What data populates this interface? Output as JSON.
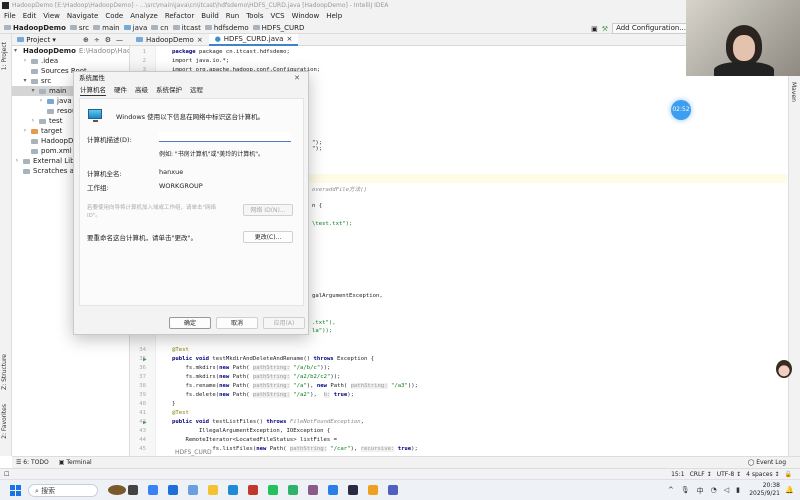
{
  "window": {
    "title": "HadoopDemo [E:\\Hadoop\\HadoopDemo] - ...\\src\\main\\java\\cn\\itcast\\hdfsdemo\\HDFS_CURD.java [HadoopDemo] - IntelliJ IDEA"
  },
  "menu": [
    "File",
    "Edit",
    "View",
    "Navigate",
    "Code",
    "Analyze",
    "Refactor",
    "Build",
    "Run",
    "Tools",
    "VCS",
    "Window",
    "Help"
  ],
  "breadcrumb": [
    "HadoopDemo",
    "src",
    "main",
    "java",
    "cn",
    "itcast",
    "hdfsdemo",
    "HDFS_CURD"
  ],
  "toolbar": {
    "add_config": "Add Configuration...",
    "project_label": "Project"
  },
  "editor_tabs": [
    "HadoopDemo",
    "HDFS_CURD.java"
  ],
  "side_tools": {
    "project": "1: Project",
    "structure": "Z: Structure",
    "favorites": "2: Favorites",
    "maven": "Maven"
  },
  "project_tree": [
    {
      "label": "HadoopDemo",
      "extra": "E:\\Hadoop\\HadoopDe",
      "depth": 0,
      "arrow": "▾",
      "icon": "module"
    },
    {
      "label": ".idea",
      "depth": 1,
      "arrow": "›",
      "icon": "folder"
    },
    {
      "label": "Sources Root",
      "depth": 1,
      "arrow": "",
      "icon": "folder"
    },
    {
      "label": "src",
      "depth": 1,
      "arrow": "▾",
      "icon": "folder"
    },
    {
      "label": "main",
      "depth": 2,
      "arrow": "▾",
      "icon": "folder",
      "selected": true
    },
    {
      "label": "java",
      "depth": 3,
      "arrow": "›",
      "icon": "folder-blue"
    },
    {
      "label": "resou",
      "depth": 3,
      "arrow": "",
      "icon": "folder"
    },
    {
      "label": "test",
      "depth": 2,
      "arrow": "›",
      "icon": "folder"
    },
    {
      "label": "target",
      "depth": 1,
      "arrow": "›",
      "icon": "folder-orange"
    },
    {
      "label": "HadoopDemo",
      "depth": 1,
      "arrow": "",
      "icon": "iml-file"
    },
    {
      "label": "pom.xml",
      "depth": 1,
      "arrow": "",
      "icon": "maven-file"
    },
    {
      "label": "External Libraries",
      "depth": 0,
      "arrow": "›",
      "icon": "library"
    },
    {
      "label": "Scratches and Co",
      "depth": 0,
      "arrow": "",
      "icon": "scratches"
    }
  ],
  "code": {
    "line1": "package cn.itcast.hdfsdemo;",
    "line2": "import java.io.*;",
    "line3": "import org.apache.hadoop.conf.Configuration;",
    "fragments": [
      "\");",
      "\");",
      "overaddFile方法()",
      "n {",
      "\\test.txt\");",
      "galArgumentException,",
      ".txt\"),",
      "la\"));"
    ],
    "lines_bottom": [
      {
        "n": "34",
        "parts": [
          [
            "ann",
            "@Test"
          ]
        ]
      },
      {
        "n": "35",
        "run": true,
        "parts": [
          [
            "kw",
            "public void "
          ],
          [
            "",
            "testMkdirAndDeleteAndRename() "
          ],
          [
            "kw",
            "throws "
          ],
          [
            "",
            "Exception {"
          ]
        ]
      },
      {
        "n": "36",
        "parts": [
          [
            "",
            "    fs.mkdirs("
          ],
          [
            "kw",
            "new "
          ],
          [
            "",
            "Path( "
          ],
          [
            "hint",
            "pathString:"
          ],
          [
            "str",
            " \"/a/b/c\""
          ],
          [
            "",
            "));"
          ]
        ]
      },
      {
        "n": "37",
        "parts": [
          [
            "",
            "    fs.mkdirs("
          ],
          [
            "kw",
            "new "
          ],
          [
            "",
            "Path( "
          ],
          [
            "hint",
            "pathString:"
          ],
          [
            "str",
            " \"/a2/b2/c2\""
          ],
          [
            "",
            "));"
          ]
        ]
      },
      {
        "n": "38",
        "parts": [
          [
            "",
            "    fs.rename("
          ],
          [
            "kw",
            "new "
          ],
          [
            "",
            "Path( "
          ],
          [
            "hint",
            "pathString:"
          ],
          [
            "str",
            " \"/a\""
          ],
          [
            "",
            "), "
          ],
          [
            "kw",
            "new "
          ],
          [
            "",
            "Path( "
          ],
          [
            "hint",
            "pathString:"
          ],
          [
            "str",
            " \"/a3\""
          ],
          [
            "",
            "));"
          ]
        ]
      },
      {
        "n": "39",
        "parts": [
          [
            "",
            "    fs.delete("
          ],
          [
            "kw",
            "new "
          ],
          [
            "",
            "Path( "
          ],
          [
            "hint",
            "pathString:"
          ],
          [
            "str",
            " \"/a2\""
          ],
          [
            "",
            "),  "
          ],
          [
            "hint",
            "b:"
          ],
          [
            "kw",
            " true"
          ],
          [
            "",
            ");"
          ]
        ]
      },
      {
        "n": "40",
        "parts": [
          [
            "",
            "}"
          ]
        ]
      },
      {
        "n": "41",
        "parts": [
          [
            "ann",
            "@Test"
          ]
        ]
      },
      {
        "n": "42",
        "run": true,
        "parts": [
          [
            "kw",
            "public void "
          ],
          [
            "",
            "testListFiles() "
          ],
          [
            "kw",
            "throws "
          ],
          [
            "comment",
            "FileNotFoundException"
          ],
          [
            "",
            ","
          ]
        ]
      },
      {
        "n": "43",
        "parts": [
          [
            "",
            "        IllegalArgumentException, IOException {"
          ]
        ]
      },
      {
        "n": "44",
        "parts": [
          [
            "",
            "    RemoteIterator<LocatedFileStatus> listFiles ="
          ]
        ]
      },
      {
        "n": "45",
        "parts": [
          [
            "",
            "            fs.listFiles("
          ],
          [
            "kw",
            "new "
          ],
          [
            "",
            "Path( "
          ],
          [
            "hint",
            "pathString:"
          ],
          [
            "str",
            " \"/car\""
          ],
          [
            "",
            "), "
          ],
          [
            "hint",
            "recursive:"
          ],
          [
            "kw",
            " true"
          ],
          [
            "",
            ");"
          ]
        ]
      }
    ],
    "file_tab": "HDFS_CURD"
  },
  "dialog": {
    "title": "系统属性",
    "tabs": [
      "计算机名",
      "硬件",
      "高级",
      "系统保护",
      "远程"
    ],
    "intro": "Windows 使用以下信息在网络中标识这台计算机。",
    "desc_label": "计算机描述(D):",
    "desc_value": "",
    "example": "例如: \"书房计算机\"或\"美玲的计算机\"。",
    "fullname_label": "计算机全名:",
    "fullname_value": "hanxue",
    "workgroup_label": "工作组:",
    "workgroup_value": "WORKGROUP",
    "network_text": "若要使用向导将计算机加入域或工作组，请单击\"网络 ID\"。",
    "network_button": "网络 ID(N)...",
    "rename_text": "要重命名这台计算机，请单击\"更改\"。",
    "change_button": "更改(C)...",
    "ok": "确定",
    "cancel": "取消",
    "apply": "应用(A)"
  },
  "bottom_tabs": {
    "todo": "6: TODO",
    "terminal": "Terminal",
    "event_log": "Event Log"
  },
  "status": {
    "position": "15:1",
    "line_sep": "CRLF",
    "encoding": "UTF-8",
    "indent": "4 spaces"
  },
  "taskbar": {
    "search": "搜索",
    "ime": "中",
    "time": "20:38",
    "date": "2025/9/21"
  },
  "overlay": {
    "timer": "02:52"
  },
  "colors": {
    "accent": "#4083c9",
    "timer": "#3d9ef0",
    "keyword": "#000080",
    "string": "#067d17"
  }
}
